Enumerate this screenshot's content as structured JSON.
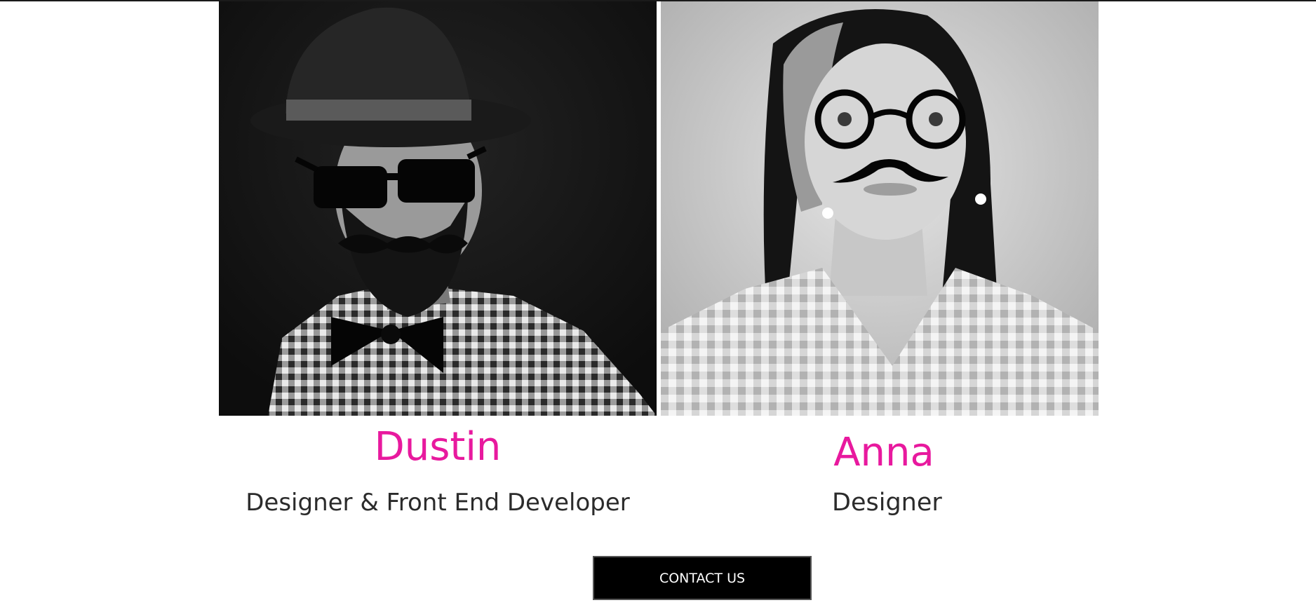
{
  "team": [
    {
      "name": "Dustin",
      "role": "Designer & Front End Developer",
      "photo_icon": "portrait-man-hat-sunglasses-mustache"
    },
    {
      "name": "Anna",
      "role": "Designer",
      "photo_icon": "portrait-woman-glasses-mustache"
    }
  ],
  "contact": {
    "label": "CONTACT US"
  },
  "colors": {
    "accent": "#e8199e",
    "role_text": "#2b2b2b",
    "button_bg": "#000000",
    "button_text": "#ffffff"
  }
}
